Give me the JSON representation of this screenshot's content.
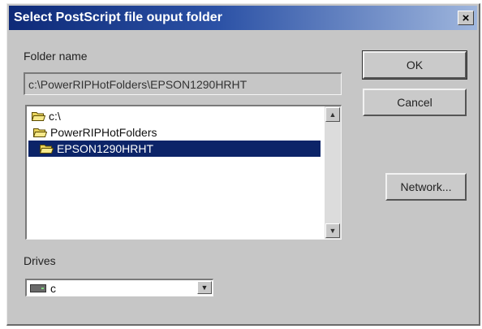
{
  "window": {
    "title": "Select PostScript file ouput folder",
    "close_glyph": "×"
  },
  "folder_name": {
    "label": "Folder name",
    "value": "c:\\PowerRIPHotFolders\\EPSON1290HRHT"
  },
  "folder_list": {
    "items": [
      {
        "label": "c:\\",
        "icon": "open-folder-icon",
        "selected": false
      },
      {
        "label": "PowerRIPHotFolders",
        "icon": "open-folder-icon",
        "selected": false
      },
      {
        "label": "EPSON1290HRHT",
        "icon": "open-folder-icon",
        "selected": true
      }
    ]
  },
  "buttons": {
    "ok": "OK",
    "cancel": "Cancel",
    "network": "Network..."
  },
  "drives": {
    "label": "Drives",
    "value": "c",
    "icon": "hard-drive-icon"
  },
  "colors": {
    "title_bar": "#0e2a78",
    "selection": "#0c2468",
    "face": "#c6c6c6"
  }
}
